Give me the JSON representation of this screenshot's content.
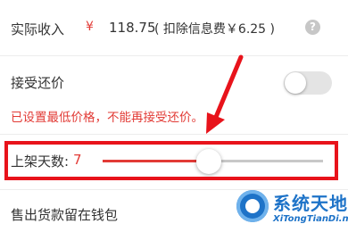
{
  "income": {
    "label": "实际收入",
    "currency": "¥",
    "value": "118.75",
    "note": "( 扣除信息费￥6.25 )",
    "help_icon": "question-circle-icon"
  },
  "offer": {
    "label": "接受还价",
    "toggle_on": false,
    "warning": "已设置最低价格，不能再接受还价。"
  },
  "listing_days": {
    "label": "上架天数:",
    "value": "7",
    "slider_fraction": 0.48
  },
  "payout": {
    "label": "售出货款留在钱包"
  },
  "watermark": {
    "title": "系统天地",
    "url": "XiTongTianDi.net"
  },
  "colors": {
    "accent": "#e23b36",
    "annotation": "#e8131b",
    "brand": "#1e73c8"
  }
}
